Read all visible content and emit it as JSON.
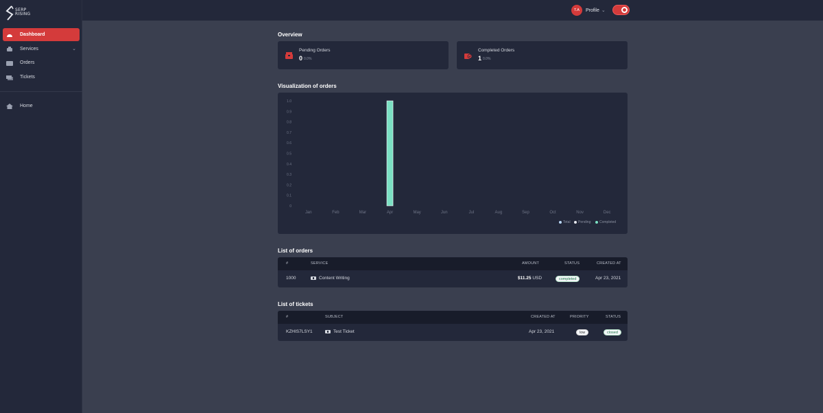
{
  "brand": {
    "logo_text_line1": "SERP",
    "logo_text_line2": "RISING"
  },
  "sidebar": {
    "items": [
      {
        "label": "Dashboard",
        "icon": "dashboard-icon",
        "active": true
      },
      {
        "label": "Services",
        "icon": "services-icon",
        "has_submenu": true
      },
      {
        "label": "Orders",
        "icon": "orders-icon"
      },
      {
        "label": "Tickets",
        "icon": "tickets-icon"
      },
      {
        "label": "Home",
        "icon": "home-icon"
      }
    ]
  },
  "header": {
    "avatar_initials": "T.A",
    "profile_label": "Profile",
    "theme_toggle": "dark-mode-toggle"
  },
  "overview": {
    "title": "Overview",
    "cards": [
      {
        "label": "Pending Orders",
        "value": "0",
        "pct": "0.0%",
        "icon": "pending-box-icon"
      },
      {
        "label": "Completed Orders",
        "value": "1",
        "pct": "0.0%",
        "icon": "completed-box-icon"
      }
    ]
  },
  "visualization": {
    "title": "Visualization of orders"
  },
  "chart_data": {
    "type": "bar",
    "categories": [
      "Jan",
      "Feb",
      "Mar",
      "Apr",
      "May",
      "Jun",
      "Jul",
      "Aug",
      "Sep",
      "Oct",
      "Nov",
      "Dec"
    ],
    "series": [
      {
        "name": "Total",
        "color": "#b8d6f5",
        "values": [
          0,
          0,
          0,
          0,
          0,
          0,
          0,
          0,
          0,
          0,
          0,
          0
        ]
      },
      {
        "name": "Pending",
        "color": "#e6e8ee",
        "values": [
          0,
          0,
          0,
          0,
          0,
          0,
          0,
          0,
          0,
          0,
          0,
          0
        ]
      },
      {
        "name": "Completed",
        "color": "#7be0c3",
        "values": [
          0,
          0,
          0,
          1,
          0,
          0,
          0,
          0,
          0,
          0,
          0,
          0
        ]
      }
    ],
    "yticks": [
      "0",
      "0.1",
      "0.2",
      "0.3",
      "0.4",
      "0.5",
      "0.6",
      "0.7",
      "0.8",
      "0.9",
      "1.0"
    ],
    "ylim": [
      0,
      1
    ],
    "legend_position": "bottom-right",
    "grid": false
  },
  "orders": {
    "title": "List of orders",
    "columns": [
      "#",
      "SERVICE",
      "AMOUNT",
      "STATUS",
      "CREATED AT"
    ],
    "rows": [
      {
        "id": "1000",
        "service": "Content Writing",
        "amount_value": "$11.25",
        "amount_currency": "USD",
        "status": "completed",
        "created_at": "Apr 23, 2021"
      }
    ]
  },
  "tickets": {
    "title": "List of tickets",
    "columns": [
      "#",
      "SUBJECT",
      "CREATED AT",
      "PRIORITY",
      "STATUS"
    ],
    "rows": [
      {
        "id": "KZHIS7LSY1",
        "subject": "Test Ticket",
        "created_at": "Apr 23, 2021",
        "priority": "low",
        "status": "closed"
      }
    ]
  }
}
